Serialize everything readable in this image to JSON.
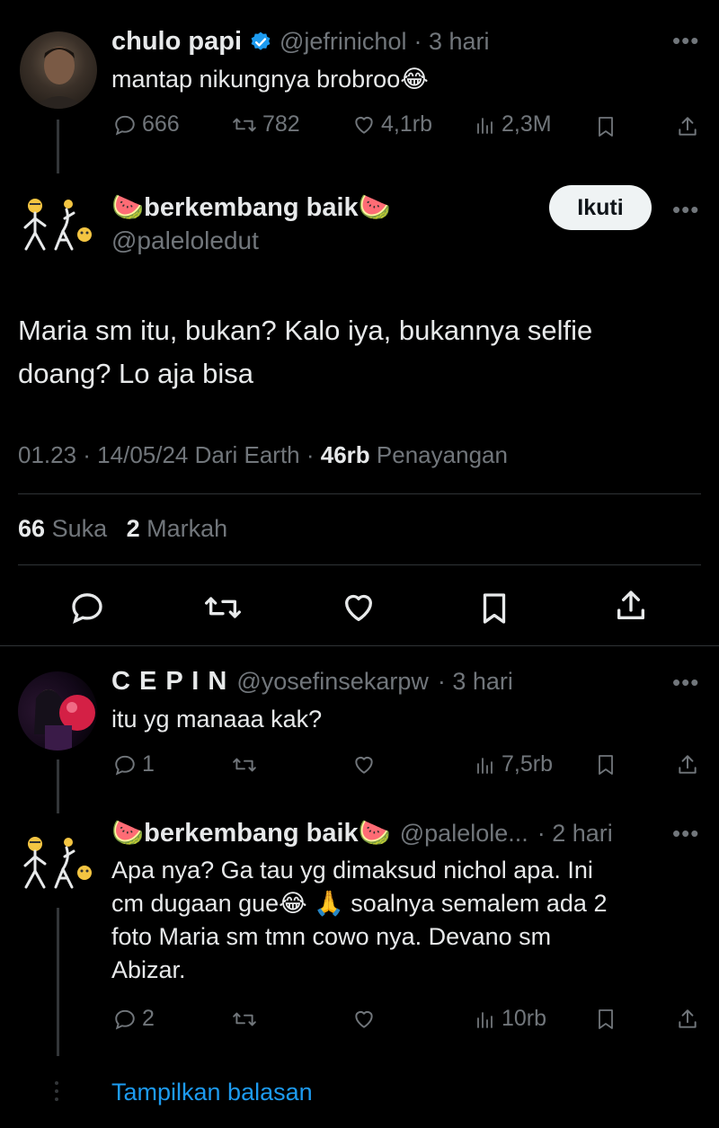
{
  "tweet1": {
    "name": "chulo papi",
    "handle": "@jefrinichol",
    "time": "· 3 hari",
    "text": "mantap nikungnya brobroo😂",
    "replies": "666",
    "retweets": "782",
    "likes": "4,1rb",
    "views": "2,3M"
  },
  "main": {
    "name": "🍉berkembang baik🍉",
    "handle": "@paleloledut",
    "follow_label": "Ikuti",
    "text_line1": "Maria sm itu, bukan? Kalo iya, bukannya selfie",
    "text_line2": "doang? Lo aja bisa",
    "meta_date": "01.23 · 14/05/24 Dari Earth ·",
    "views_count": "46rb",
    "views_label": "Penayangan",
    "likes_count": "66",
    "likes_label": "Suka",
    "bookmarks_count": "2",
    "bookmarks_label": "Markah"
  },
  "reply1": {
    "name": "C E P I N",
    "handle": "@yosefinsekarpw",
    "time": "· 3 hari",
    "text": "itu yg manaaa kak?",
    "replies": "1",
    "views": "7,5rb"
  },
  "reply2": {
    "name": "🍉berkembang baik🍉",
    "handle": "@palelole...",
    "time": "· 2 hari",
    "line1": "Apa nya? Ga tau yg dimaksud nichol apa. Ini",
    "line2": "cm dugaan gue😂 🙏  soalnya semalem ada 2",
    "line3": "foto Maria sm tmn cowo nya. Devano sm",
    "line4": "Abizar.",
    "replies": "2",
    "views": "10rb"
  },
  "show_replies": "Tampilkan balasan",
  "colors": {
    "background": "#000000",
    "text": "#e7e9ea",
    "muted": "#71767b",
    "link": "#1d9bf0",
    "verified": "#1d9bf0"
  }
}
